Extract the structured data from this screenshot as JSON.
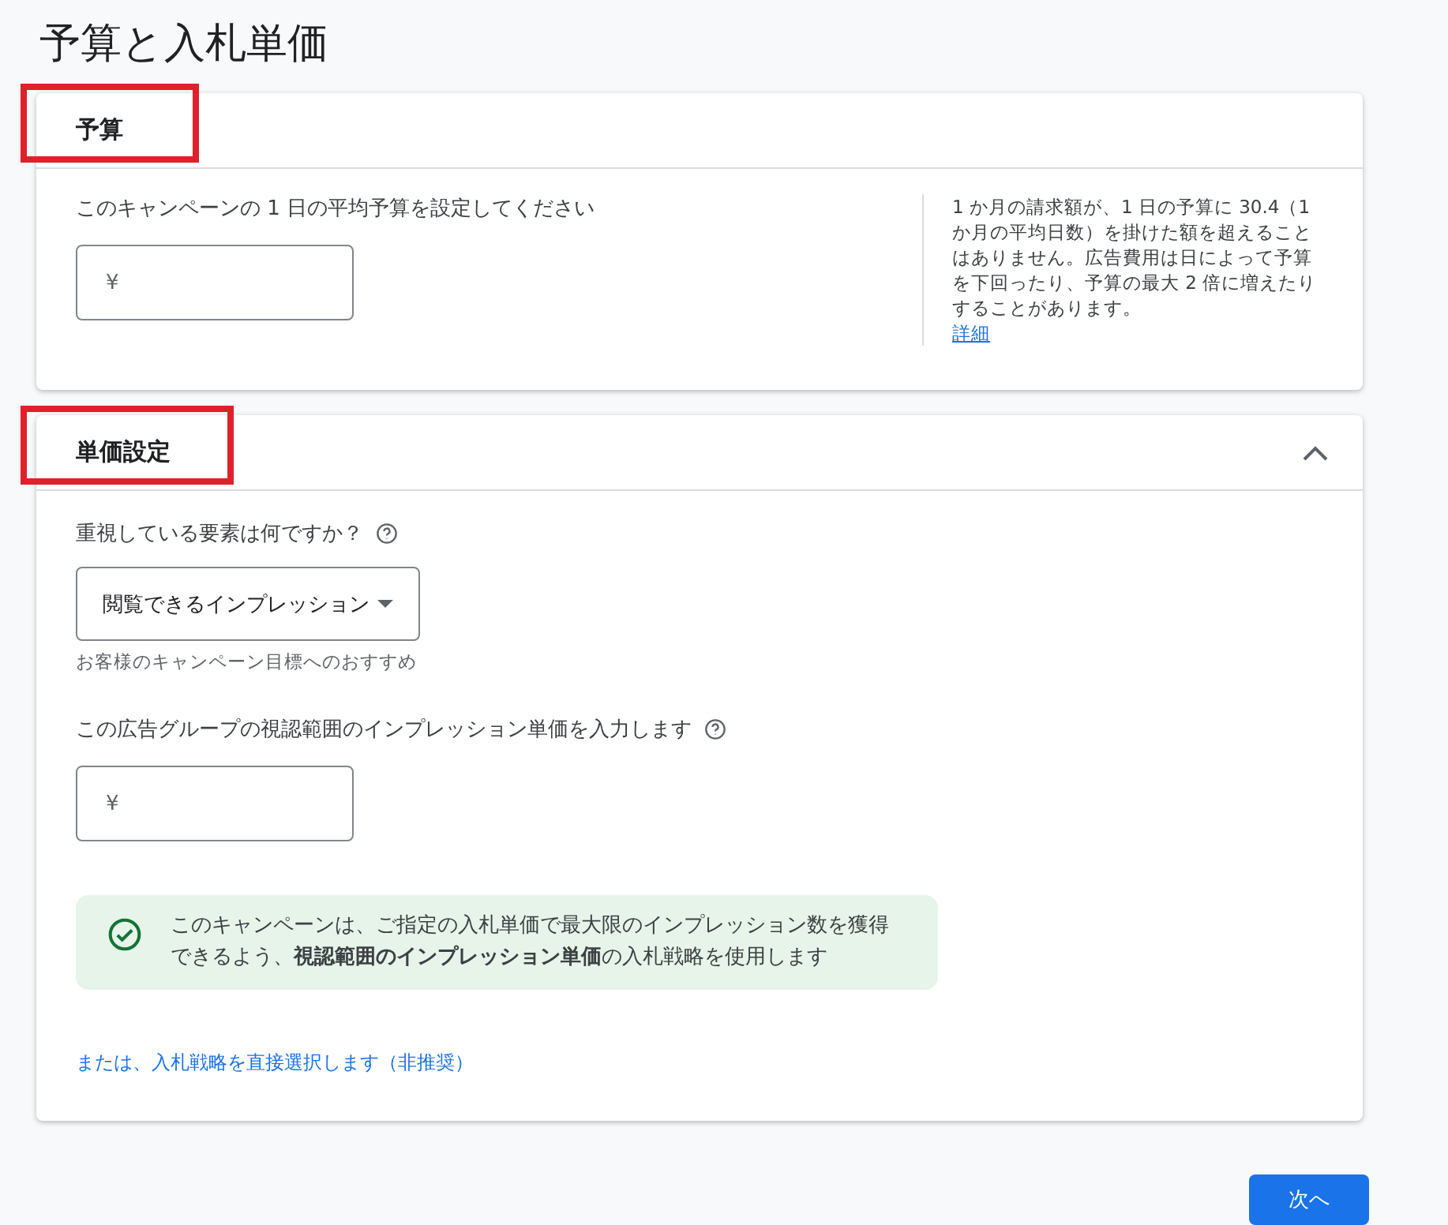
{
  "page_title": "予算と入札単価",
  "budget": {
    "title": "予算",
    "highlighted": true,
    "label": "このキャンペーンの 1 日の平均予算を設定してください",
    "currency": "¥",
    "note": "1 か月の請求額が、1 日の予算に 30.4（1 か月の平均日数）を掛けた額を超えることはありません。広告費用は日によって予算を下回ったり、予算の最大 2 倍に増えたりすることがあります。",
    "note_link": "詳細"
  },
  "bidding": {
    "title": "単価設定",
    "highlighted": true,
    "expanded": true,
    "focus_label": "重視している要素は何ですか？",
    "focus_value": "閲覧できるインプレッション",
    "focus_hint": "お客様のキャンペーン目標へのおすすめ",
    "cpm_label": "この広告グループの視認範囲のインプレッション単価を入力します",
    "currency": "¥",
    "info": "このキャンペーンは、ご指定の入札単価で最大限のインプレッション数を獲得できるよう、**視認範囲のインプレッション単価**の入札戦略を使用します",
    "strategy_link": "または、入札戦略を直接選択します（非推奨）"
  },
  "next_button": "次へ"
}
